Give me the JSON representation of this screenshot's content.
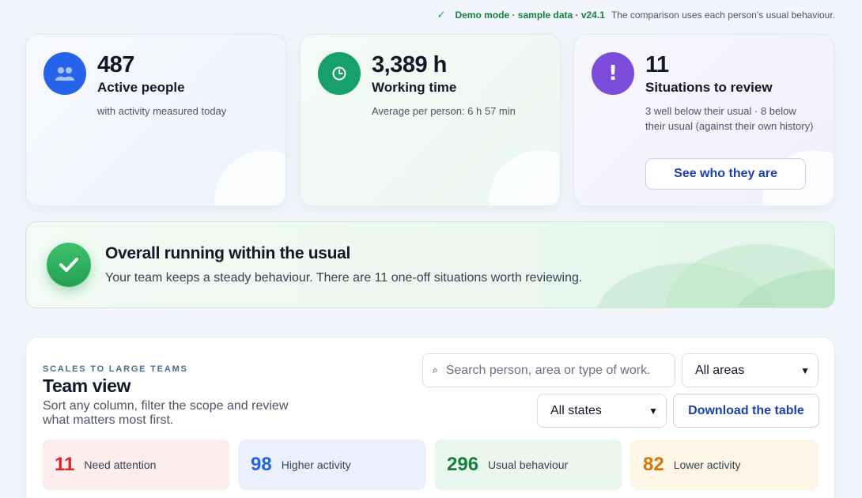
{
  "topbar": {
    "demo": "Demo mode · sample data · v24.1",
    "note": "The comparison uses each person's usual behaviour."
  },
  "kpis": [
    {
      "value": "487",
      "label": "Active people",
      "sub": "with activity measured today",
      "icon": "people-icon",
      "color": "#2563eb"
    },
    {
      "value": "3,389 h",
      "label": "Working time",
      "sub": "Average per person: 6 h 57 min",
      "icon": "clock-icon",
      "color": "#16a06a"
    },
    {
      "value": "11",
      "label": "Situations to review",
      "sub": "3 well below their usual · 8 below their usual (against their own history)",
      "icon": "exclamation-icon",
      "color": "#7c4ddb",
      "button": "See who they are"
    }
  ],
  "overall": {
    "title": "Overall running within the usual",
    "desc": "Your team keeps a steady behaviour. There are 11 one-off situations worth reviewing.",
    "icon": "checkmark-icon"
  },
  "team": {
    "eyebrow": "SCALES TO LARGE TEAMS",
    "heading": "Team view",
    "lede": "Sort any column, filter the scope and review what matters most first.",
    "search_placeholder": "Search person, area or type of work.",
    "areas_value": "All areas",
    "states_value": "All states",
    "download_label": "Download the table",
    "summary": [
      {
        "count": "11",
        "label": "Need attention",
        "color": "#dc2626"
      },
      {
        "count": "98",
        "label": "Higher activity",
        "color": "#2563eb"
      },
      {
        "count": "296",
        "label": "Usual behaviour",
        "color": "#15803d"
      },
      {
        "count": "82",
        "label": "Lower activity",
        "color": "#d97706"
      }
    ]
  }
}
